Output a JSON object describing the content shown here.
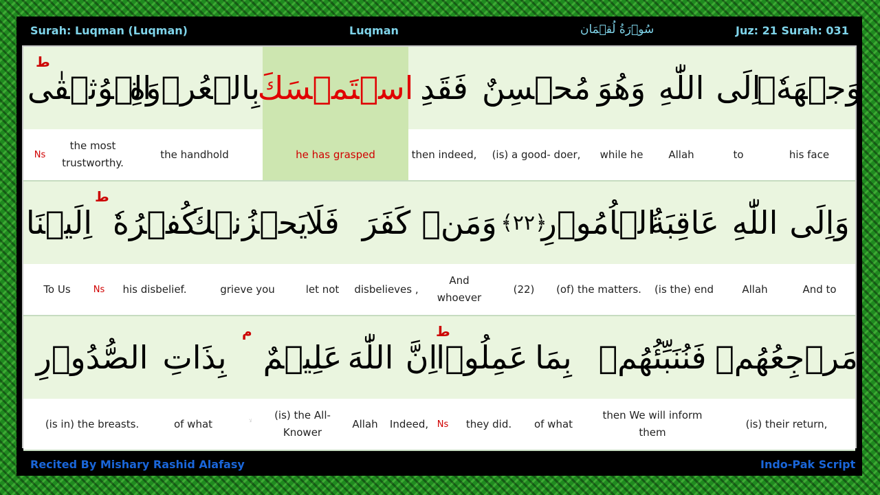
{
  "header": {
    "surah": "Surah: Luqman (Luqman)",
    "name": "Luqman",
    "arabic_name": "سُوۡرَةُ لُقۡمَان",
    "juz_surah": "Juz: 21  Surah: 031"
  },
  "footer": {
    "reciter": "Recited By Mishary Rashid Alafasy",
    "script": "Indo-Pak Script"
  },
  "rows": [
    {
      "arabic": [
        "وَجۡهَهٗۤ",
        "اِلَى",
        "اللّٰهِ",
        "وَهُوَ",
        "مُحۡسِنٌ",
        "فَقَدِ",
        "اسۡتَمۡسَكَ",
        "بِالۡعُرۡوَةِ",
        "الۡوُثۡقٰى"
      ],
      "pause": "ط",
      "translation": [
        "his face",
        "to",
        "Allah",
        "while he",
        "(is) a good- doer,",
        "then indeed,",
        "he has grasped",
        "the handhold",
        "the most trustworthy.",
        "Ns"
      ]
    },
    {
      "arabic": [
        "وَاِلَى",
        "اللّٰهِ",
        "عَاقِبَةُ",
        "الۡاُمُوۡرِ",
        "﴿۲۲﴾",
        "وَمَنۡ",
        "كَفَرَ",
        "فَلَا",
        "يَحۡزُنۡكَ",
        "كُفۡرُهٗ",
        "اِلَيۡنَا"
      ],
      "pause": "ط",
      "translation": [
        "And to",
        "Allah",
        "(is the) end",
        "(of) the matters.",
        "(22)",
        "And whoever",
        "disbelieves ,",
        "let not",
        "grieve you",
        "his disbelief.",
        "Ns",
        "To Us"
      ]
    },
    {
      "arabic": [
        "مَرۡجِعُهُمۡ",
        "فَنُنَبِّئُهُمۡ",
        "بِمَا",
        "عَمِلُوۡا",
        "اِنَّ",
        "اللّٰهَ",
        "عَلِيۡمٌ",
        "بِذَاتِ",
        "الصُّدُوۡرِ"
      ],
      "pause": "ط",
      "pause2": "م",
      "translation": [
        "(is) their return,",
        "then We will inform them",
        "of what",
        "they did.",
        "Ns",
        "Indeed,",
        "Allah",
        "(is) the All-Knower",
        "ۙ",
        "of what",
        "(is in) the breasts."
      ]
    }
  ]
}
